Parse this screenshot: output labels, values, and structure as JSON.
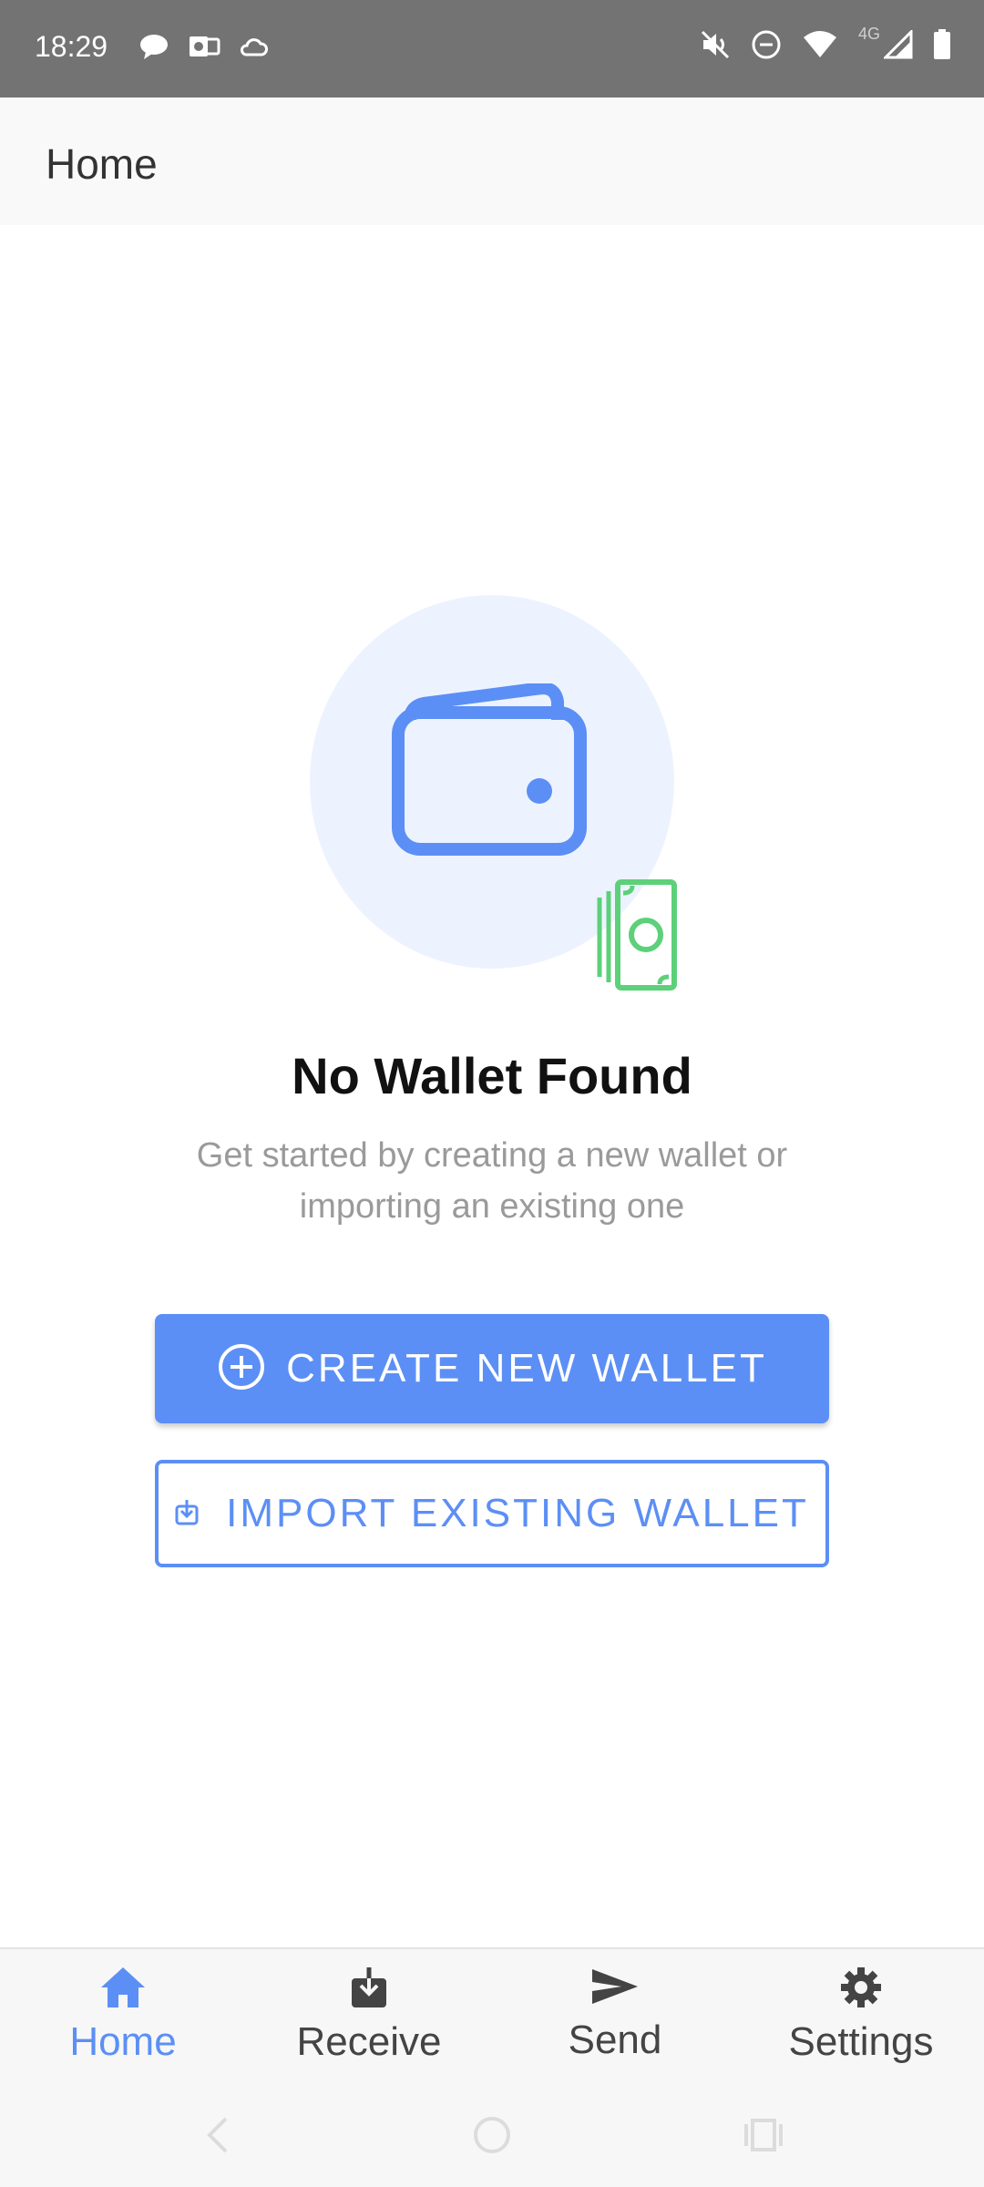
{
  "status_bar": {
    "time": "18:29",
    "network": "4G",
    "left_icons": [
      "chat-icon",
      "outlook-icon",
      "cloud-icon"
    ],
    "right_icons": [
      "mute-icon",
      "dnd-icon",
      "wifi-icon",
      "signal-icon",
      "battery-icon"
    ]
  },
  "app_bar": {
    "title": "Home"
  },
  "empty_state": {
    "title": "No Wallet Found",
    "subtitle": "Get started by creating a new wallet or importing an existing one",
    "illustration": [
      "wallet-icon",
      "money-icon"
    ]
  },
  "actions": {
    "create_label": "CREATE NEW WALLET",
    "import_label": "IMPORT EXISTING WALLET"
  },
  "bottom_nav": {
    "items": [
      {
        "label": "Home",
        "icon": "home-icon",
        "active": true
      },
      {
        "label": "Receive",
        "icon": "receive-icon",
        "active": false
      },
      {
        "label": "Send",
        "icon": "send-icon",
        "active": false
      },
      {
        "label": "Settings",
        "icon": "settings-icon",
        "active": false
      }
    ]
  },
  "system_nav": [
    "back-icon",
    "home-circle-icon",
    "recents-icon"
  ],
  "colors": {
    "accent": "#5c8ff5",
    "hero_bg": "#edf3fe",
    "money_green": "#5dd07a",
    "status_bar": "#737373"
  }
}
